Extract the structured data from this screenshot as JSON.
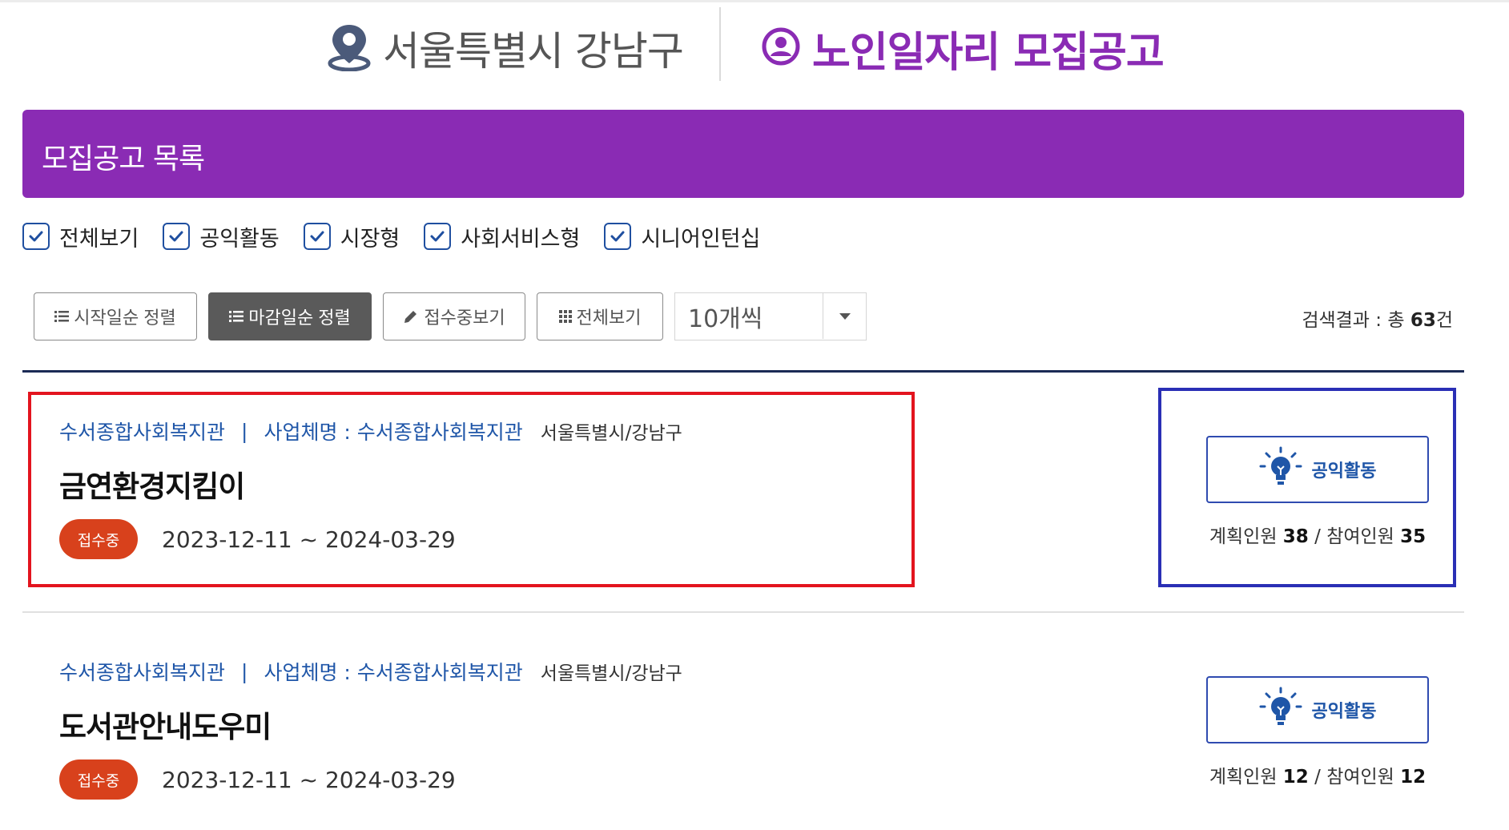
{
  "header": {
    "region": "서울특별시 강남구",
    "title": "노인일자리 모집공고"
  },
  "banner": {
    "title": "모집공고 목록"
  },
  "filters": [
    {
      "label": "전체보기",
      "checked": true
    },
    {
      "label": "공익활동",
      "checked": true
    },
    {
      "label": "시장형",
      "checked": true
    },
    {
      "label": "사회서비스형",
      "checked": true
    },
    {
      "label": "시니어인턴십",
      "checked": true
    }
  ],
  "toolbar": {
    "sort_start": "시작일순 정렬",
    "sort_deadline": "마감일순 정렬",
    "view_open": "접수중보기",
    "view_all": "전체보기",
    "per_page": "10개씩",
    "results_prefix": "검색결과 : 총 ",
    "results_count": "63",
    "results_suffix": "건"
  },
  "listings": [
    {
      "org": "수서종합사회복지관",
      "separator": "|",
      "business": "사업체명 : 수서종합사회복지관",
      "location": "서울특별시/강남구",
      "title": "금연환경지킴이",
      "status": "접수중",
      "period": "2023-12-11 ~ 2024-03-29",
      "type": "공익활동",
      "planned_label": "계획인원 ",
      "planned": "38",
      "slash": " / ",
      "joined_label": "참여인원 ",
      "joined": "35"
    },
    {
      "org": "수서종합사회복지관",
      "separator": "|",
      "business": "사업체명 : 수서종합사회복지관",
      "location": "서울특별시/강남구",
      "title": "도서관안내도우미",
      "status": "접수중",
      "period": "2023-12-11 ~ 2024-03-29",
      "type": "공익활동",
      "planned_label": "계획인원 ",
      "planned": "12",
      "slash": " / ",
      "joined_label": "참여인원 ",
      "joined": "12"
    }
  ],
  "colors": {
    "brand_purple": "#8a2bb4",
    "link_blue": "#1f56a8",
    "status_red": "#d8411c",
    "highlight_red": "#e3141e",
    "highlight_blue": "#2a2fb5"
  },
  "icons": {
    "region": "location-pin-icon",
    "title": "person-circle-icon",
    "checkbox": "check-icon",
    "sort": "list-icon",
    "view_open": "pencil-icon",
    "view_all": "grid-icon",
    "select": "caret-down-icon",
    "type": "lightbulb-icon"
  }
}
